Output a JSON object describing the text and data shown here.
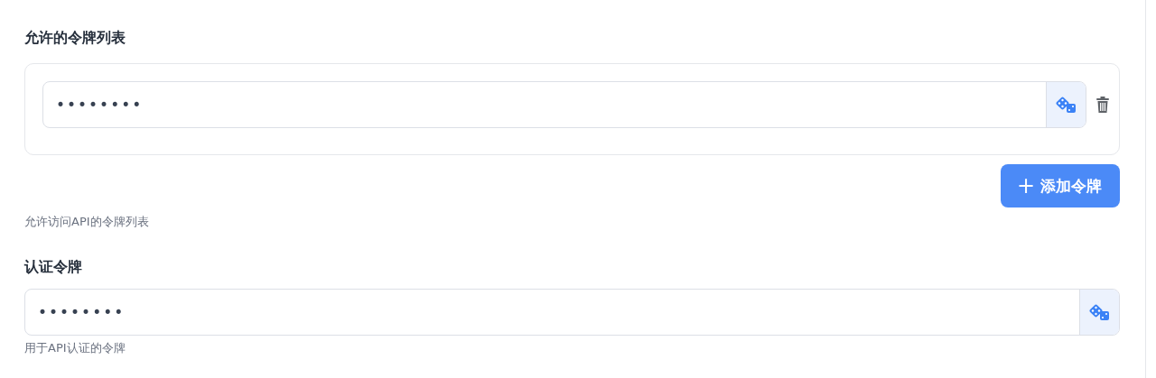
{
  "token_list": {
    "label": "允许的令牌列表",
    "tokens": [
      {
        "value": "••••••••"
      }
    ],
    "add_button": {
      "icon": "+",
      "label": "添加令牌"
    },
    "hint": "允许访问API的令牌列表"
  },
  "auth_token": {
    "label": "认证令牌",
    "value": "••••••••",
    "hint": "用于API认证的令牌"
  }
}
